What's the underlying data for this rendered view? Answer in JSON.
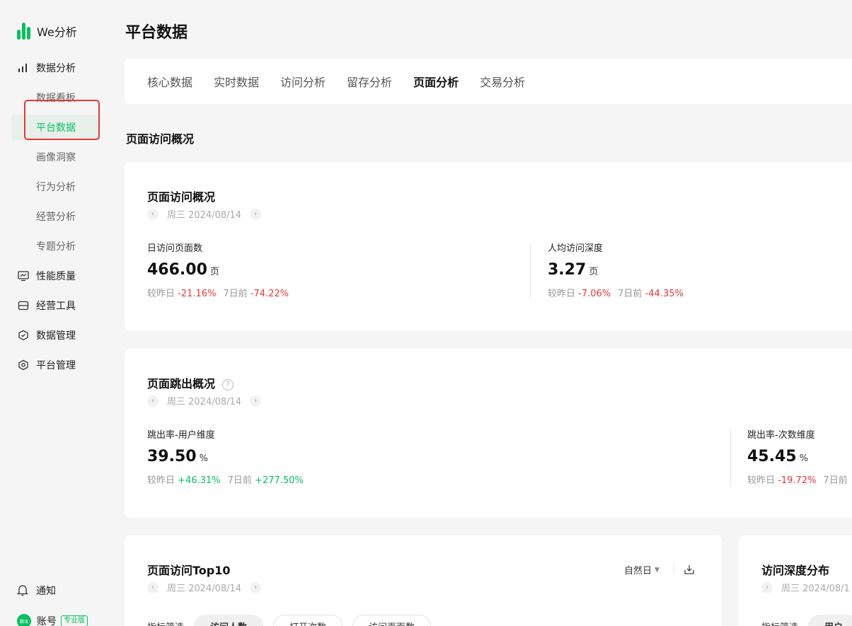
{
  "app": {
    "logo_text": "We分析",
    "brand_color": "#07c160"
  },
  "sidebar": {
    "groups": [
      {
        "label": "数据分析",
        "icon": "bar-chart-icon"
      },
      {
        "label": "性能质量",
        "icon": "monitor-icon"
      },
      {
        "label": "经营工具",
        "icon": "toolbox-icon"
      },
      {
        "label": "数据管理",
        "icon": "shield-check-icon"
      },
      {
        "label": "平台管理",
        "icon": "hexagon-gear-icon"
      }
    ],
    "sub_items": [
      "数据看板",
      "平台数据",
      "画像洞察",
      "行为分析",
      "经营分析",
      "专题分析"
    ],
    "active_item": "平台数据",
    "bottom": {
      "notify_label": "通知",
      "account_label": "账号",
      "account_badge": "专业版",
      "avatar_text": "腾讯"
    }
  },
  "main": {
    "page_title": "平台数据",
    "tabs": [
      "核心数据",
      "实时数据",
      "访问分析",
      "留存分析",
      "页面分析",
      "交易分析"
    ],
    "active_tab": "页面分析",
    "section_title": "页面访问概况",
    "visit_card": {
      "title": "页面访问概况",
      "date": "周三 2024/08/14",
      "metrics": [
        {
          "label": "日访问页面数",
          "value": "466.00",
          "unit": "页",
          "prev_label": "较昨日",
          "prev_value": "-21.16%",
          "week_label": "7日前",
          "week_value": "-74.22%"
        },
        {
          "label": "人均访问深度",
          "value": "3.27",
          "unit": "页",
          "prev_label": "较昨日",
          "prev_value": "-7.06%",
          "week_label": "7日前",
          "week_value": "-44.35%"
        }
      ]
    },
    "bounce_card": {
      "title": "页面跳出概况",
      "help": "?",
      "date": "周三 2024/08/14",
      "metrics": [
        {
          "label": "跳出率-用户维度",
          "value": "39.50",
          "unit": "%",
          "prev_label": "较昨日",
          "prev_value": "+46.31%",
          "week_label": "7日前",
          "week_value": "+277.50%"
        },
        {
          "label": "跳出率-次数维度",
          "value": "45.45",
          "unit": "%",
          "prev_label": "较昨日",
          "prev_value": "-19.72%",
          "week_label": "7日前",
          "week_value": ""
        }
      ]
    },
    "top10_card": {
      "title": "页面访问Top10",
      "date": "周三 2024/08/14",
      "dropdown": "自然日",
      "filter_label": "指标筛选",
      "chips": [
        "访问人数",
        "打开次数",
        "访问页面数"
      ]
    },
    "depth_card": {
      "title": "访问深度分布",
      "date": "周三 2024/08/1",
      "filter_label": "指标筛选",
      "chip": "用户"
    }
  }
}
